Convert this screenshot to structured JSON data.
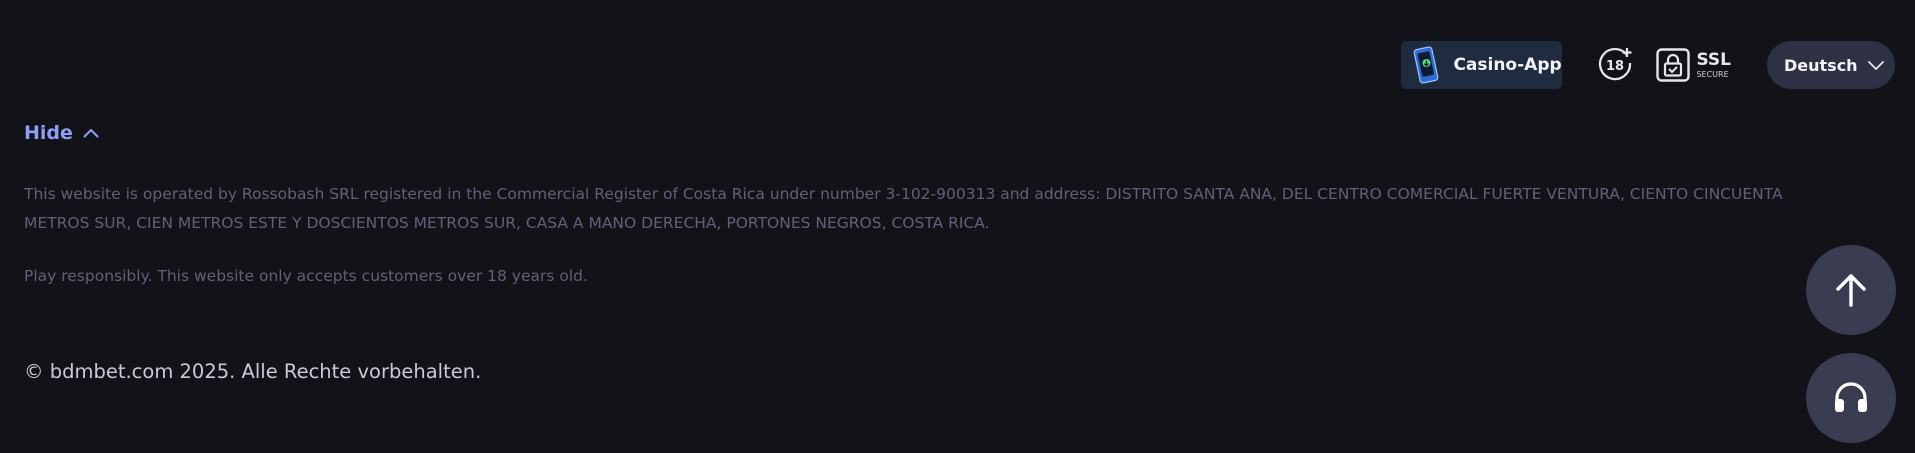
{
  "header": {
    "app_button_label": "Casino-App",
    "age_badge_text": "18",
    "ssl_main": "SSL",
    "ssl_sub": "SECURE",
    "language": "Deutsch"
  },
  "footer": {
    "hide_label": "Hide",
    "legal_text": "This website is operated by Rossobash SRL registered in the Commercial Register of Costa Rica under number 3-102-900313 and address: DISTRITO SANTA ANA, DEL CENTRO COMERCIAL FUERTE VENTURA, CIENTO CINCUENTA METROS SUR, CIEN METROS ESTE Y DOSCIENTOS METROS SUR, CASA A MANO DERECHA, PORTONES NEGROS, COSTA RICA.",
    "responsible_text": "Play responsibly. This website only accepts customers over 18 years old.",
    "copyright": "© bdmbet.com 2025. Alle Rechte vorbehalten."
  },
  "floating_buttons": {
    "scroll_top_icon": "arrow-up-icon",
    "support_icon": "headset-icon"
  },
  "colors": {
    "background": "#121319",
    "accent_link": "#8e9ef5",
    "muted_text": "#5f6178",
    "app_button_bg": "#1f2b3f",
    "pill_bg": "#2e3043",
    "fab_bg": "#3a3c52"
  }
}
